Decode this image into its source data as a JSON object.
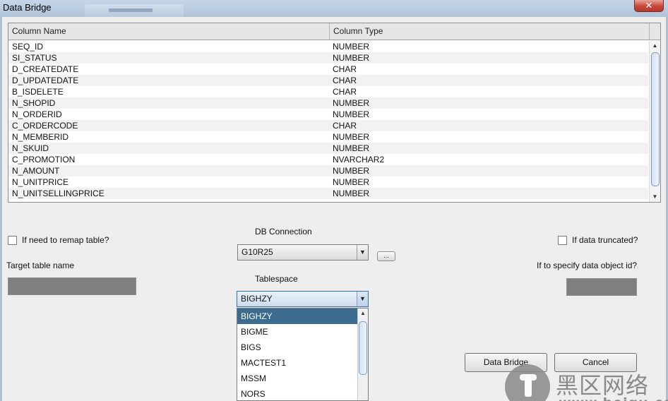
{
  "window": {
    "title": "Data Bridge",
    "close_glyph": "✕"
  },
  "columns_table": {
    "headers": [
      "Column Name",
      "Column Type"
    ],
    "rows": [
      [
        "SEQ_ID",
        "NUMBER"
      ],
      [
        "SI_STATUS",
        "NUMBER"
      ],
      [
        "D_CREATEDATE",
        "CHAR"
      ],
      [
        "D_UPDATEDATE",
        "CHAR"
      ],
      [
        "B_ISDELETE",
        "CHAR"
      ],
      [
        "N_SHOPID",
        "NUMBER"
      ],
      [
        "N_ORDERID",
        "NUMBER"
      ],
      [
        "C_ORDERCODE",
        "CHAR"
      ],
      [
        "N_MEMBERID",
        "NUMBER"
      ],
      [
        "N_SKUID",
        "NUMBER"
      ],
      [
        "C_PROMOTION",
        "NVARCHAR2"
      ],
      [
        "N_AMOUNT",
        "NUMBER"
      ],
      [
        "N_UNITPRICE",
        "NUMBER"
      ],
      [
        "N_UNITSELLINGPRICE",
        "NUMBER"
      ]
    ]
  },
  "options": {
    "remap_label": "If need to remap table?",
    "remap_checked": false,
    "target_table_label": "Target table name",
    "target_table_value": "",
    "truncated_label": "If data truncated?",
    "truncated_checked": false,
    "object_id_label": "If to specify data object id?",
    "object_id_value": ""
  },
  "db_connection": {
    "label": "DB Connection",
    "value": "G10R25",
    "browse_label": "..."
  },
  "tablespace": {
    "label": "Tablespace",
    "value": "BIGHZY",
    "options": [
      "BIGHZY",
      "BIGME",
      "BIGS",
      "MACTEST1",
      "MSSM",
      "NORS"
    ],
    "selected_index": 0
  },
  "buttons": {
    "data_bridge": "Data Bridge",
    "cancel": "Cancel"
  },
  "watermark": {
    "cn": "黑区网络",
    "url": "www.heiqu.com"
  },
  "colors": {
    "selection": "#3b6b8f",
    "titlebar": "#b8cade",
    "close": "#c7463a",
    "field_fill": "#7f7f7f"
  }
}
